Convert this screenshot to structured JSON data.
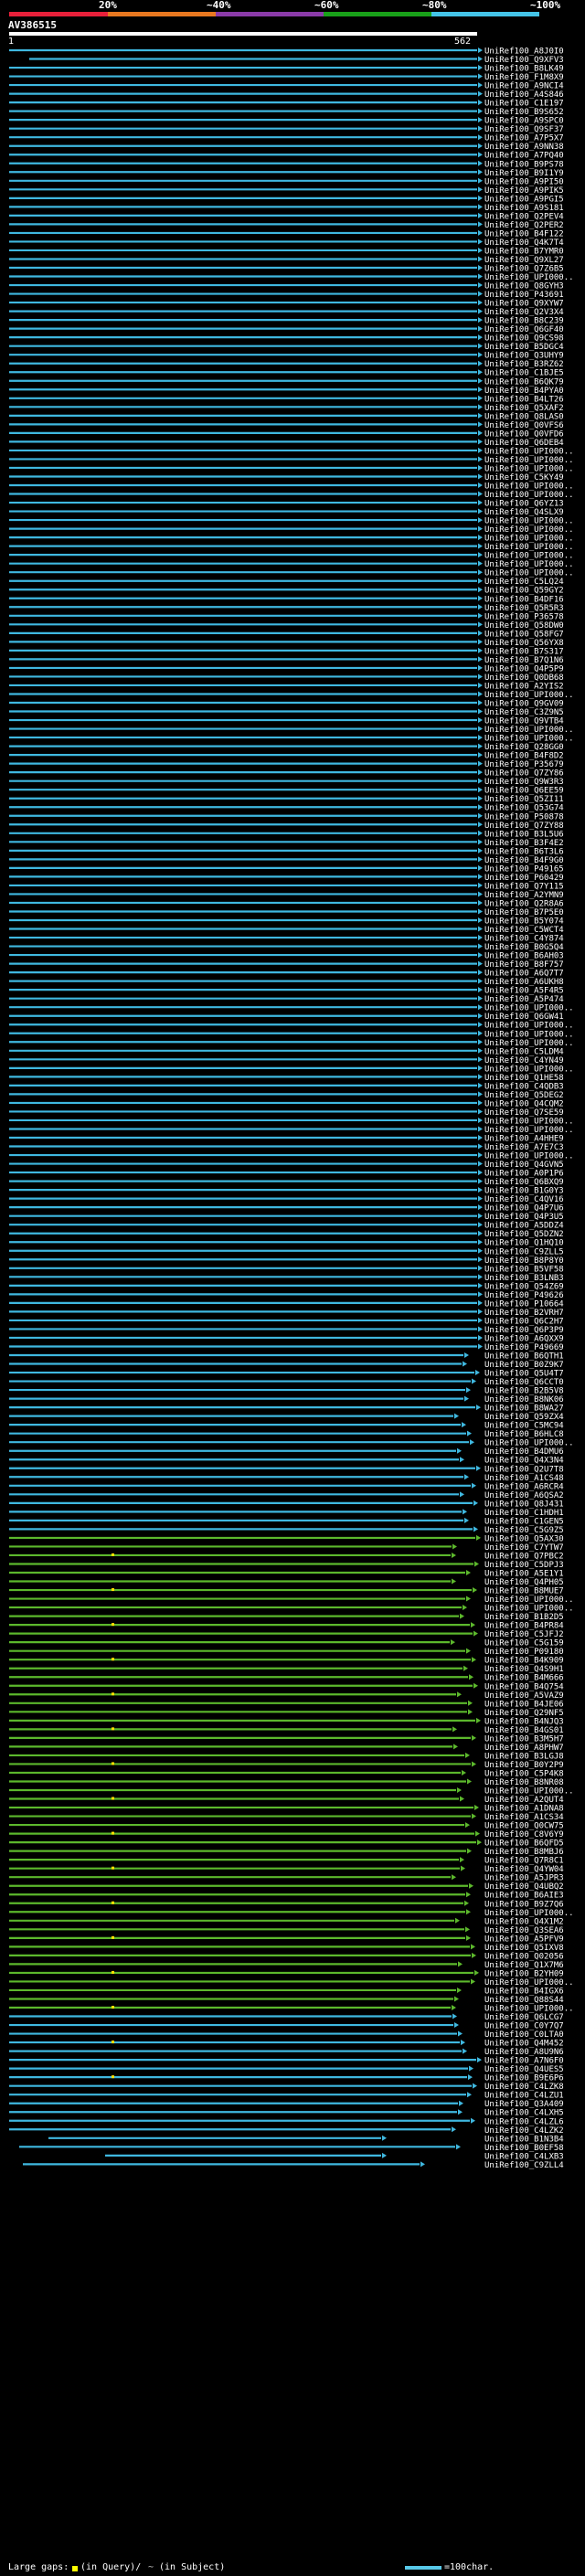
{
  "scale": {
    "labels": [
      "20%",
      "~40%",
      "~60%",
      "~80%",
      "~100%"
    ],
    "segments": [
      {
        "color": "#e8203a"
      },
      {
        "color": "#e87820"
      },
      {
        "color": "#8a3aa8"
      },
      {
        "color": "#19a019"
      },
      {
        "color": "#44c4e8"
      }
    ]
  },
  "query": {
    "name": "AV386515",
    "start": "1",
    "end": "562"
  },
  "colors": {
    "cyan": "#3fb8e0",
    "green": "#5cb82c",
    "dot": "#ffe000",
    "white": "#ffffff"
  },
  "hit_names": [
    "UniRef100_A8J0I0",
    "UniRef100_Q9XFV3",
    "UniRef100_B8LK49",
    "UniRef100_F1M8X9",
    "UniRef100_A9NCI4",
    "UniRef100_A4S846",
    "UniRef100_C1E197",
    "UniRef100_B9S652",
    "UniRef100_A9SPC0",
    "UniRef100_Q9SF37",
    "UniRef100_A7P5X7",
    "UniRef100_A9NN38",
    "UniRef100_A7PQ40",
    "UniRef100_B9PS78",
    "UniRef100_B9I1Y9",
    "UniRef100_A9PI50",
    "UniRef100_A9PIK5",
    "UniRef100_A9PGI5",
    "UniRef100_A9S181",
    "UniRef100_Q2PEV4",
    "UniRef100_Q2PER2",
    "UniRef100_B4F122",
    "UniRef100_Q4K7T4",
    "UniRef100_B7YMR0",
    "UniRef100_Q9XL27",
    "UniRef100_Q7Z6B5",
    "UniRef100_UPI000..",
    "UniRef100_Q8GYH3",
    "UniRef100_P43691",
    "UniRef100_Q9XYW7",
    "UniRef100_Q2V3X4",
    "UniRef100_B8C239",
    "UniRef100_Q6GF40",
    "UniRef100_Q9CS98",
    "UniRef100_B5DGC4",
    "UniRef100_Q3UHY9",
    "UniRef100_B3RZ62",
    "UniRef100_C1BJE5",
    "UniRef100_B6QK79",
    "UniRef100_B4PYA0",
    "UniRef100_B4LT26",
    "UniRef100_Q5XAF2",
    "UniRef100_Q8LAS0",
    "UniRef100_Q0VFS6",
    "UniRef100_Q0VFD6",
    "UniRef100_Q6DEB4",
    "UniRef100_UPI000..",
    "UniRef100_UPI000..",
    "UniRef100_UPI000..",
    "UniRef100_C5KY49",
    "UniRef100_UPI000..",
    "UniRef100_UPI000..",
    "UniRef100_Q6YZ13",
    "UniRef100_Q4SLX9",
    "UniRef100_UPI000..",
    "UniRef100_UPI000..",
    "UniRef100_UPI000..",
    "UniRef100_UPI000..",
    "UniRef100_UPI000..",
    "UniRef100_UPI000..",
    "UniRef100_UPI000..",
    "UniRef100_C5LQ24",
    "UniRef100_Q59GY2",
    "UniRef100_B4DF16",
    "UniRef100_Q5R5R3",
    "UniRef100_P36578",
    "UniRef100_Q58DW0",
    "UniRef100_Q58FG7",
    "UniRef100_Q56YX8",
    "UniRef100_B7S317",
    "UniRef100_B7Q1N6",
    "UniRef100_Q4P5P9",
    "UniRef100_Q0DB68",
    "UniRef100_A2YIS2",
    "UniRef100_UPI000..",
    "UniRef100_Q9GV09",
    "UniRef100_C3Z9N5",
    "UniRef100_Q9VTB4",
    "UniRef100_UPI000..",
    "UniRef100_UPI000..",
    "UniRef100_Q28GG0",
    "UniRef100_B4F8D2",
    "UniRef100_P35679",
    "UniRef100_Q7ZY86",
    "UniRef100_Q9W3R3",
    "UniRef100_Q6EE59",
    "UniRef100_Q5ZI11",
    "UniRef100_Q53G74",
    "UniRef100_P50878",
    "UniRef100_Q7ZY88",
    "UniRef100_B3L5U6",
    "UniRef100_B3F4E2",
    "UniRef100_B6T3L6",
    "UniRef100_B4F9G0",
    "UniRef100_P49165",
    "UniRef100_P60429",
    "UniRef100_Q7Y115",
    "UniRef100_A2YMN9",
    "UniRef100_Q2R8A6",
    "UniRef100_B7P5E0",
    "UniRef100_B5Y074",
    "UniRef100_C5WCT4",
    "UniRef100_C4Y874",
    "UniRef100_B0G5Q4",
    "UniRef100_B6AH03",
    "UniRef100_B8F757",
    "UniRef100_A6Q7T7",
    "UniRef100_A6UKH8",
    "UniRef100_A5F4R5",
    "UniRef100_A5P474",
    "UniRef100_UPI000..",
    "UniRef100_Q6GW41",
    "UniRef100_UPI000..",
    "UniRef100_UPI000..",
    "UniRef100_UPI000..",
    "UniRef100_C5LDM4",
    "UniRef100_C4YN49",
    "UniRef100_UPI000..",
    "UniRef100_Q1HE58",
    "UniRef100_C4QDB3",
    "UniRef100_Q5DEG2",
    "UniRef100_Q4CQM2",
    "UniRef100_Q7SE59",
    "UniRef100_UPI000..",
    "UniRef100_UPI000..",
    "UniRef100_A4HHE9",
    "UniRef100_A7E7C3",
    "UniRef100_UPI000..",
    "UniRef100_Q4GVN5",
    "UniRef100_A0P1P6",
    "UniRef100_Q6BXQ9",
    "UniRef100_B1G0Y3",
    "UniRef100_C4QV16",
    "UniRef100_Q4P7U6",
    "UniRef100_Q4P3U5",
    "UniRef100_A5DDZ4",
    "UniRef100_Q5DZN2",
    "UniRef100_Q1HQ10",
    "UniRef100_C9ZLL5",
    "UniRef100_B8P8Y0",
    "UniRef100_B5VF58",
    "UniRef100_B3LNB3",
    "UniRef100_Q54Z69",
    "UniRef100_P49626",
    "UniRef100_P10664",
    "UniRef100_B2VRH7",
    "UniRef100_Q6C2H7",
    "UniRef100_Q6P3P9",
    "UniRef100_A6QXX9",
    "UniRef100_P49669",
    "UniRef100_B6QTH1",
    "UniRef100_B0Z9K7",
    "UniRef100_Q5U4T7",
    "UniRef100_Q6CCT0",
    "UniRef100_B2B5V8",
    "UniRef100_B8NK06",
    "UniRef100_B8WA27",
    "UniRef100_Q59ZX4",
    "UniRef100_C5MC94",
    "UniRef100_B6HLC8",
    "UniRef100_UPI000..",
    "UniRef100_B4DMU6",
    "UniRef100_Q4X3N4",
    "UniRef100_Q2U7T8",
    "UniRef100_A1CS48",
    "UniRef100_A6RCR4",
    "UniRef100_A6QSA2",
    "UniRef100_Q8J431",
    "UniRef100_C1HDH1",
    "UniRef100_C1GEN5",
    "UniRef100_C5G9Z5",
    "UniRef100_Q5AX30",
    "UniRef100_C7YTW7",
    "UniRef100_Q7PBC2",
    "UniRef100_C5DPJ3",
    "UniRef100_A5E1Y1",
    "UniRef100_Q4PH05",
    "UniRef100_B8MUE7",
    "UniRef100_UPI000..",
    "UniRef100_UPI000..",
    "UniRef100_B1B2D5",
    "UniRef100_B4PR84",
    "UniRef100_C5JFJ2",
    "UniRef100_C5G159",
    "UniRef100_P09180",
    "UniRef100_B4K909",
    "UniRef100_Q4S9H1",
    "UniRef100_B4M666",
    "UniRef100_B4Q754",
    "UniRef100_A5VAZ9",
    "UniRef100_B4JE06",
    "UniRef100_Q29NF5",
    "UniRef100_B4NJQ3",
    "UniRef100_B4GS01",
    "UniRef100_B3M5H7",
    "UniRef100_A8PHW7",
    "UniRef100_B3LGJ8",
    "UniRef100_B0Y2P9",
    "UniRef100_C5P4K8",
    "UniRef100_B8NR08",
    "UniRef100_UPI000..",
    "UniRef100_A2QUT4",
    "UniRef100_A1DNA8",
    "UniRef100_A1CS34",
    "UniRef100_Q0CW75",
    "UniRef100_C8V6Y9",
    "UniRef100_B6QFD5",
    "UniRef100_B8MBJ6",
    "UniRef100_Q7R8C1",
    "UniRef100_Q4YW04",
    "UniRef100_A5JPR3",
    "UniRef100_Q4UBQ2",
    "UniRef100_B6AIE3",
    "UniRef100_B9Z7Q6",
    "UniRef100_UPI000..",
    "UniRef100_Q4X1M2",
    "UniRef100_Q3SEA6",
    "UniRef100_A5PFV9",
    "UniRef100_Q5IXV8",
    "UniRef100_Q02056",
    "UniRef100_Q1X7M6",
    "UniRef100_B2YH09",
    "UniRef100_UPI000..",
    "UniRef100_B4IGX6",
    "UniRef100_Q88S44",
    "UniRef100_UPI000..",
    "UniRef100_Q6LCG7",
    "UniRef100_C0Y7Q7",
    "UniRef100_C0LTA0",
    "UniRef100_Q4M452",
    "UniRef100_A8U9N6",
    "UniRef100_A7N6F0",
    "UniRef100_Q4UES5",
    "UniRef100_B9E6P6",
    "UniRef100_C4LZK8",
    "UniRef100_C4LZU1",
    "UniRef100_Q3A409",
    "UniRef100_C4LXH5",
    "UniRef100_C4LZL6",
    "UniRef100_C4LZK2",
    "UniRef100_B1N3B4",
    "UniRef100_B0EF58",
    "UniRef100_C4LXB3",
    "UniRef100_C9ZLL4"
  ],
  "footer": {
    "gaps_label": "Large gaps:",
    "in_query": "(in Query)/",
    "tilde": "~",
    "in_subject": "(in Subject)",
    "length_label": "=100char."
  }
}
